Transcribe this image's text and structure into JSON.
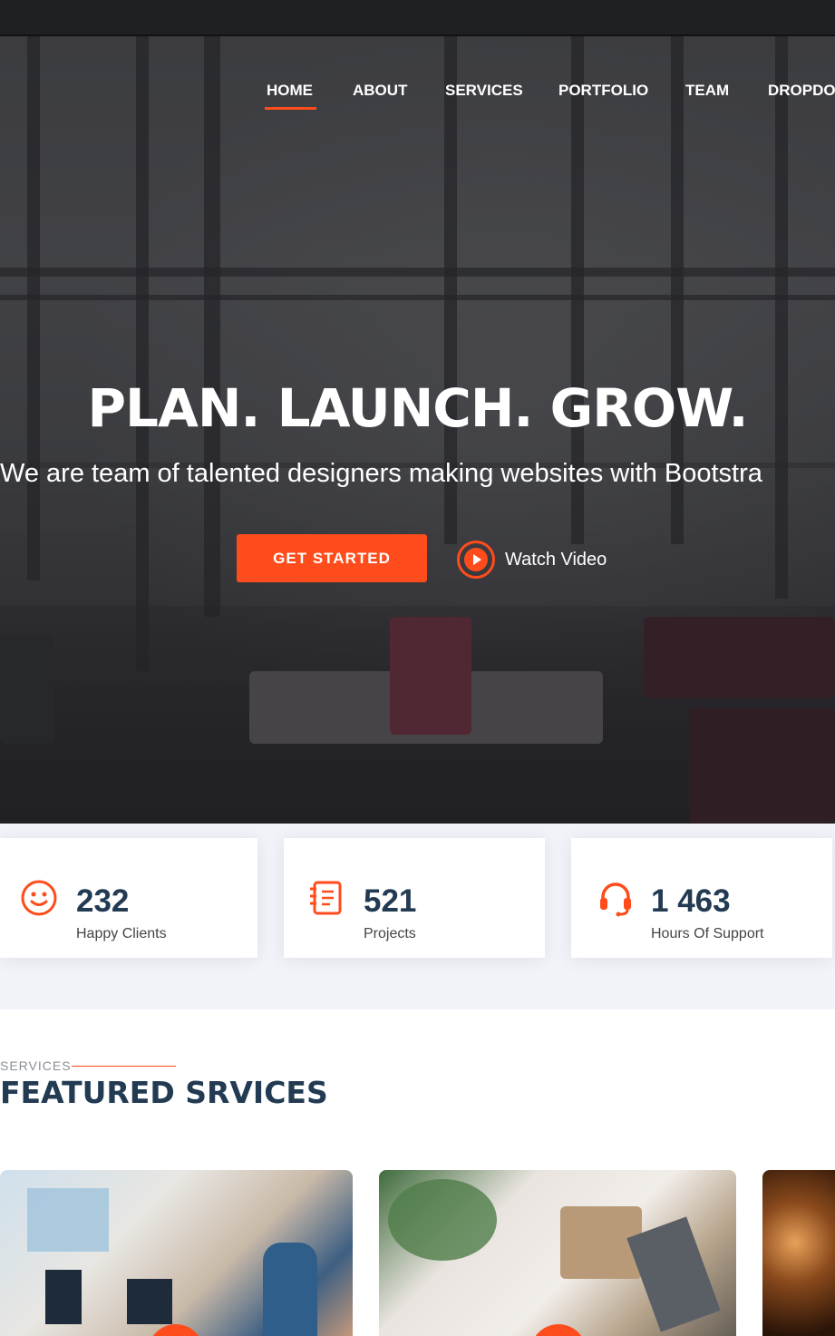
{
  "nav": {
    "items": [
      {
        "label": "HOME",
        "active": true
      },
      {
        "label": "ABOUT"
      },
      {
        "label": "SERVICES"
      },
      {
        "label": "PORTFOLIO"
      },
      {
        "label": "TEAM"
      },
      {
        "label": "DROPDO"
      }
    ]
  },
  "hero": {
    "title": "PLAN. LAUNCH. GROW.",
    "subtitle": "We are team of talented designers making websites with Bootstra",
    "cta_label": "GET STARTED",
    "watch_label": "Watch Video"
  },
  "stats": [
    {
      "value": "232",
      "label": "Happy Clients",
      "icon": "smile-icon"
    },
    {
      "value": "521",
      "label": "Projects",
      "icon": "journal-icon"
    },
    {
      "value": "1 463",
      "label": "Hours Of Support",
      "icon": "headset-icon"
    }
  ],
  "services": {
    "kicker": "SERVICES",
    "title": "FEATURED SRVICES"
  },
  "colors": {
    "accent": "#fe4c1c",
    "heading": "#223a52",
    "stats_bg": "#f1f3f9"
  }
}
